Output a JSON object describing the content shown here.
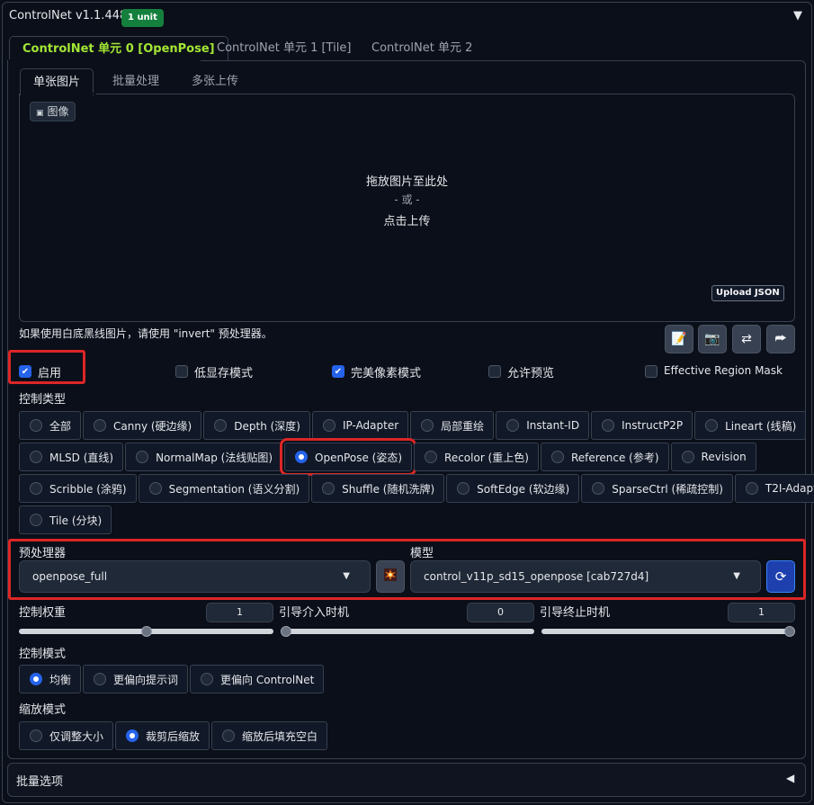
{
  "header": {
    "title": "ControlNet v1.1.448",
    "badge": "1 unit",
    "collapse_icon": "caret-down-icon"
  },
  "unit_tabs": [
    {
      "label": "ControlNet 单元 0 [OpenPose]",
      "active": true
    },
    {
      "label": "ControlNet 单元 1 [Tile]",
      "active": false
    },
    {
      "label": "ControlNet 单元 2",
      "active": false
    }
  ],
  "image_tabs": [
    {
      "label": "单张图片",
      "active": true
    },
    {
      "label": "批量处理",
      "active": false
    },
    {
      "label": "多张上传",
      "active": false
    }
  ],
  "dropzone": {
    "image_label": "图像",
    "line1": "拖放图片至此处",
    "line2": "- 或 -",
    "line3": "点击上传",
    "upload_json": "Upload JSON"
  },
  "hint": "如果使用白底黑线图片，请使用 \"invert\" 预处理器。",
  "tool_buttons": [
    "edit-icon",
    "camera-icon",
    "swap-icon",
    "send-icon"
  ],
  "checkboxes": [
    {
      "label": "启用",
      "checked": true
    },
    {
      "label": "低显存模式",
      "checked": false
    },
    {
      "label": "完美像素模式",
      "checked": true
    },
    {
      "label": "允许预览",
      "checked": false
    },
    {
      "label": "Effective Region Mask",
      "checked": false
    }
  ],
  "control_type": {
    "label": "控制类型",
    "options": [
      [
        "全部",
        "Canny (硬边缘)",
        "Depth (深度)",
        "IP-Adapter",
        "局部重绘",
        "Instant-ID",
        "InstructP2P",
        "Lineart (线稿)"
      ],
      [
        "MLSD (直线)",
        "NormalMap (法线贴图)",
        "OpenPose (姿态)",
        "Recolor (重上色)",
        "Reference (参考)",
        "Revision"
      ],
      [
        "Scribble (涂鸦)",
        "Segmentation (语义分割)",
        "Shuffle (随机洗牌)",
        "SoftEdge (软边缘)",
        "SparseCtrl (稀疏控制)",
        "T2I-Adapter"
      ],
      [
        "Tile (分块)"
      ]
    ],
    "selected": "OpenPose (姿态)"
  },
  "preprocessor": {
    "label": "预处理器",
    "value": "openpose_full",
    "run_icon": "explosion-icon"
  },
  "model": {
    "label": "模型",
    "value": "control_v11p_sd15_openpose [cab727d4]",
    "refresh_icon": "refresh-icon"
  },
  "sliders": [
    {
      "label": "控制权重",
      "value": "1",
      "fraction": 0.5
    },
    {
      "label": "引导介入时机",
      "value": "0",
      "fraction": 0.0
    },
    {
      "label": "引导终止时机",
      "value": "1",
      "fraction": 1.0
    }
  ],
  "control_mode": {
    "label": "控制模式",
    "options": [
      "均衡",
      "更偏向提示词",
      "更偏向 ControlNet"
    ],
    "selected": "均衡"
  },
  "resize_mode": {
    "label": "缩放模式",
    "options": [
      "仅调整大小",
      "裁剪后缩放",
      "缩放后填充空白"
    ],
    "selected": "裁剪后缩放"
  },
  "batch_options": {
    "label": "批量选项",
    "icon": "caret-left-icon"
  }
}
